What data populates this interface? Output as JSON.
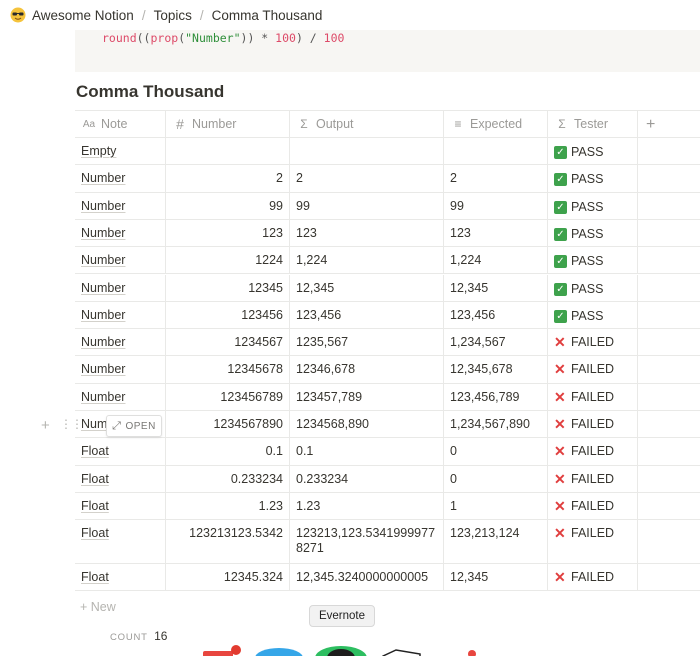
{
  "breadcrumb": {
    "items": [
      "Awesome Notion",
      "Topics",
      "Comma Thousand"
    ],
    "separator": "/"
  },
  "code": {
    "line_fn1": "round",
    "line_p1": "((",
    "line_fn2": "prop",
    "line_p2": "(",
    "line_str": "\"Number\"",
    "line_p3": "))",
    "line_op": " * ",
    "line_num1": "100",
    "line_p4": ") ",
    "line_op2": "/ ",
    "line_num2": "100"
  },
  "title": "Comma Thousand",
  "table": {
    "columns": [
      {
        "label": "Note",
        "icon": "text-icon"
      },
      {
        "label": "Number",
        "icon": "hash-icon"
      },
      {
        "label": "Output",
        "icon": "sigma-icon"
      },
      {
        "label": "Expected",
        "icon": "lines-icon"
      },
      {
        "label": "Tester",
        "icon": "sigma-icon"
      }
    ],
    "rows": [
      {
        "note": "Empty",
        "number": "",
        "output": "",
        "expected": "",
        "tester": "PASS",
        "status": "pass"
      },
      {
        "note": "Number",
        "number": "2",
        "output": "2",
        "expected": "2",
        "tester": "PASS",
        "status": "pass"
      },
      {
        "note": "Number",
        "number": "99",
        "output": "99",
        "expected": "99",
        "tester": "PASS",
        "status": "pass"
      },
      {
        "note": "Number",
        "number": "123",
        "output": "123",
        "expected": "123",
        "tester": "PASS",
        "status": "pass"
      },
      {
        "note": "Number",
        "number": "1224",
        "output": "1,224",
        "expected": "1,224",
        "tester": "PASS",
        "status": "pass"
      },
      {
        "note": "Number",
        "number": "12345",
        "output": "12,345",
        "expected": "12,345",
        "tester": "PASS",
        "status": "pass"
      },
      {
        "note": "Number",
        "number": "123456",
        "output": "123,456",
        "expected": "123,456",
        "tester": "PASS",
        "status": "pass"
      },
      {
        "note": "Number",
        "number": "1234567",
        "output": "1235,567",
        "expected": "1,234,567",
        "tester": "FAILED",
        "status": "fail"
      },
      {
        "note": "Number",
        "number": "12345678",
        "output": "12346,678",
        "expected": "12,345,678",
        "tester": "FAILED",
        "status": "fail"
      },
      {
        "note": "Number",
        "number": "123456789",
        "output": "123457,789",
        "expected": "123,456,789",
        "tester": "FAILED",
        "status": "fail"
      },
      {
        "note": "Numl",
        "number": "1234567890",
        "output": "1234568,890",
        "expected": "1,234,567,890",
        "tester": "FAILED",
        "status": "fail"
      },
      {
        "note": "Float",
        "number": "0.1",
        "output": "0.1",
        "expected": "0",
        "tester": "FAILED",
        "status": "fail"
      },
      {
        "note": "Float",
        "number": "0.233234",
        "output": "0.233234",
        "expected": "0",
        "tester": "FAILED",
        "status": "fail"
      },
      {
        "note": "Float",
        "number": "1.23",
        "output": "1.23",
        "expected": "1",
        "tester": "FAILED",
        "status": "fail"
      },
      {
        "note": "Float",
        "number": "123213123.5342",
        "output": "123213,123.53419999778271",
        "expected": "123,213,124",
        "tester": "FAILED",
        "status": "fail"
      },
      {
        "note": "Float",
        "number": "12345.324",
        "output": "12,345.3240000000005",
        "expected": "12,345",
        "tester": "FAILED",
        "status": "fail"
      }
    ],
    "add_column": "+",
    "new_row": "+ New",
    "open_button": "OPEN",
    "count_label": "COUNT",
    "count_value": "16"
  },
  "tooltip": "Evernote",
  "colors": {
    "pass": "#3ea24c",
    "fail": "#e03e3e",
    "code_bg": "#f7f6f3",
    "border": "#e9e9e7"
  }
}
